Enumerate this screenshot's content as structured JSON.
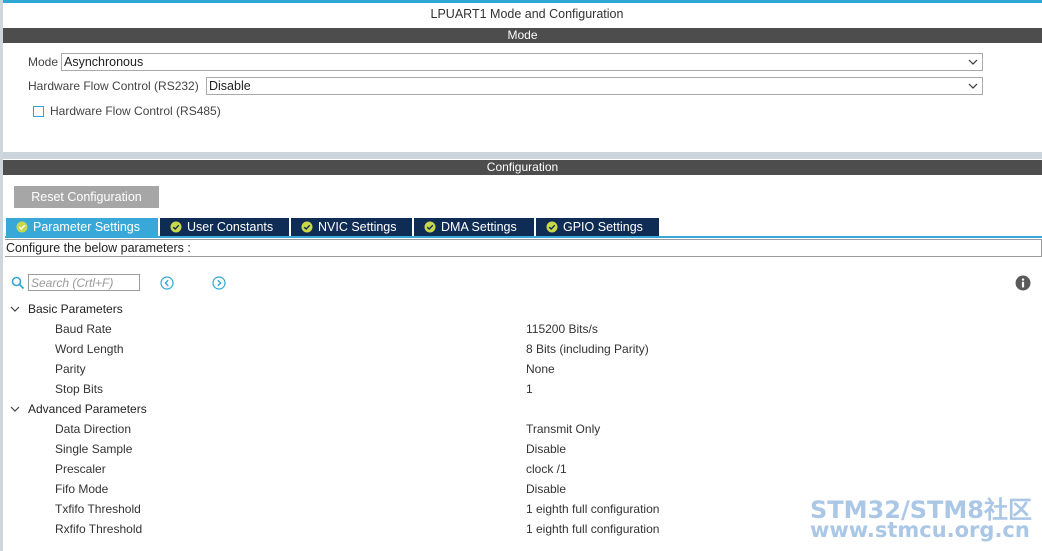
{
  "window": {
    "title": "LPUART1 Mode and Configuration"
  },
  "mode_section": {
    "header": "Mode",
    "mode_label": "Mode",
    "mode_value": "Asynchronous",
    "rs232_label": "Hardware Flow Control (RS232)",
    "rs232_value": "Disable",
    "rs485_label": "Hardware Flow Control (RS485)",
    "rs485_checked": false
  },
  "config_section": {
    "header": "Configuration",
    "reset_label": "Reset Configuration",
    "tabs": [
      {
        "label": "Parameter Settings",
        "active": true
      },
      {
        "label": "User Constants",
        "active": false
      },
      {
        "label": "NVIC Settings",
        "active": false
      },
      {
        "label": "DMA Settings",
        "active": false
      },
      {
        "label": "GPIO Settings",
        "active": false
      }
    ],
    "hint": "Configure the below parameters :",
    "search_placeholder": "Search (Crtl+F)"
  },
  "groups": [
    {
      "name": "Basic Parameters",
      "params": [
        {
          "name": "Baud Rate",
          "value": "115200 Bits/s"
        },
        {
          "name": "Word Length",
          "value": "8 Bits (including Parity)"
        },
        {
          "name": "Parity",
          "value": "None"
        },
        {
          "name": "Stop Bits",
          "value": "1"
        }
      ]
    },
    {
      "name": "Advanced Parameters",
      "params": [
        {
          "name": "Data Direction",
          "value": "Transmit Only"
        },
        {
          "name": "Single Sample",
          "value": "Disable"
        },
        {
          "name": "Prescaler",
          "value": "clock /1"
        },
        {
          "name": "Fifo Mode",
          "value": "Disable"
        },
        {
          "name": "Txfifo Threshold",
          "value": "1 eighth full configuration"
        },
        {
          "name": "Rxfifo Threshold",
          "value": "1 eighth full configuration"
        }
      ]
    }
  ],
  "watermark": {
    "line1": "STM32/STM8社区",
    "line2": "www.stmcu.org.cn"
  },
  "colors": {
    "accent": "#38a8d8",
    "tab_dark": "#0f2d54",
    "bar": "#4d4d4d",
    "check_green": "#c8d84a"
  },
  "icons": [
    "search-icon",
    "arrow-left-circle-icon",
    "arrow-right-circle-icon",
    "info-icon",
    "check-circle-icon",
    "chevron-down-icon"
  ]
}
